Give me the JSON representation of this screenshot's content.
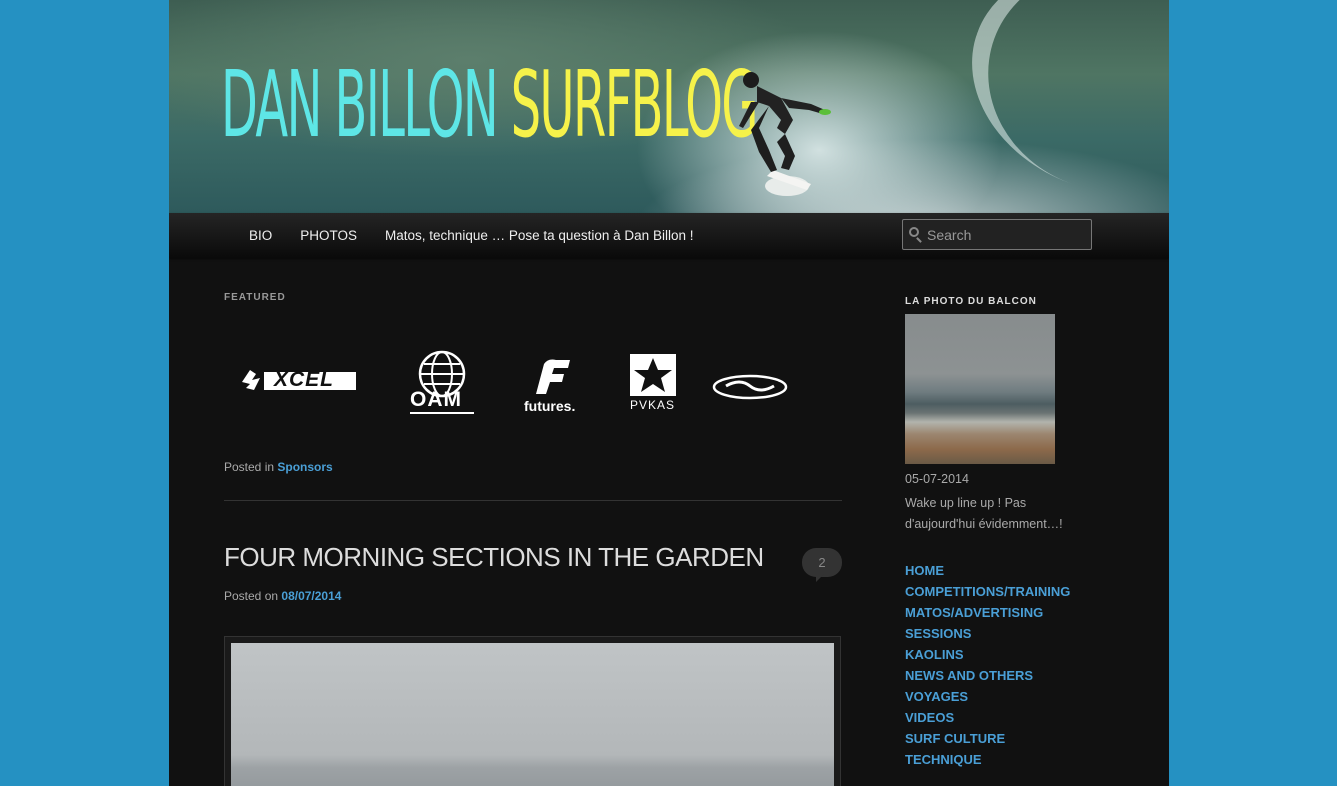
{
  "header": {
    "title_part1": "DAN BILLON",
    "title_part2": "SURFBLOG"
  },
  "nav": {
    "items": [
      {
        "label": "BIO"
      },
      {
        "label": "PHOTOS"
      },
      {
        "label": "Matos, technique … Pose ta question à Dan Billon !"
      }
    ],
    "search_placeholder": "Search"
  },
  "featured": {
    "label": "FEATURED",
    "sponsors": [
      "XCEL",
      "OAM",
      "futures.",
      "PVKAS"
    ],
    "posted_in_prefix": "Posted in",
    "posted_in_category": "Sponsors"
  },
  "post": {
    "title": "FOUR MORNING SECTIONS IN THE GARDEN",
    "comment_count": "2",
    "posted_on_prefix": "Posted on",
    "date": "08/07/2014"
  },
  "sidebar": {
    "widget_title": "LA PHOTO DU BALCON",
    "photo_date": "05-07-2014",
    "photo_caption": "Wake up line up ! Pas d'aujourd'hui évidemment…!",
    "categories": [
      "HOME",
      "COMPETITIONS/TRAINING",
      "MATOS/ADVERTISING",
      "SESSIONS",
      "KAOLINS",
      "NEWS AND OTHERS",
      "VOYAGES",
      "VIDEOS",
      "SURF CULTURE",
      "TECHNIQUE"
    ]
  },
  "colors": {
    "outer_background": "#2591c2",
    "page_background": "#111111",
    "link_blue": "#4a9fd6",
    "title_cyan": "#5ee6e6",
    "title_pink": "#f07ee8",
    "title_yellow": "#f6f24a"
  }
}
